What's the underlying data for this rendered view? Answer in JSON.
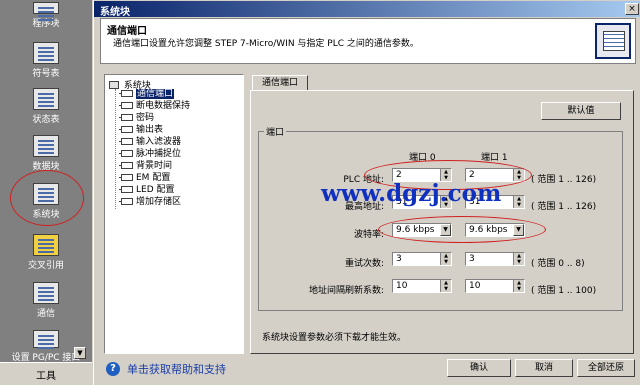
{
  "nav": {
    "items": [
      {
        "label": "程序块"
      },
      {
        "label": "符号表"
      },
      {
        "label": "状态表"
      },
      {
        "label": "数据块"
      },
      {
        "label": "系统块"
      },
      {
        "label": "交叉引用"
      },
      {
        "label": "通信"
      },
      {
        "label": "设置 PG/PC 接口"
      }
    ],
    "tools_label": "工具"
  },
  "dialog": {
    "title": "系统块",
    "close": "×",
    "header_title": "通信端口",
    "header_desc": "通信端口设置允许您调整 STEP 7-Micro/WIN 与指定 PLC 之间的通信参数。"
  },
  "tree": {
    "root": "系统块",
    "items": [
      {
        "label": "通信端口",
        "selected": true
      },
      {
        "label": "断电数据保持"
      },
      {
        "label": "密码"
      },
      {
        "label": "输出表"
      },
      {
        "label": "输入滤波器"
      },
      {
        "label": "脉冲捕捉位"
      },
      {
        "label": "背景时间"
      },
      {
        "label": "EM 配置"
      },
      {
        "label": "LED 配置"
      },
      {
        "label": "增加存储区"
      }
    ]
  },
  "panel": {
    "tab": "通信端口",
    "default_button": "默认值",
    "group_label": "端口",
    "col_port0": "端口 0",
    "col_port1": "端口 1",
    "rows": [
      {
        "label": "PLC 地址:",
        "port0": "2",
        "port1": "2",
        "range": "( 范围 1 .. 126)"
      },
      {
        "label": "最高地址:",
        "port0": "31",
        "port1": "31",
        "range": "( 范围 1 .. 126)"
      },
      {
        "label": "波特率:",
        "port0": "9.6 kbps",
        "port1": "9.6 kbps",
        "range": ""
      },
      {
        "label": "重试次数:",
        "port0": "3",
        "port1": "3",
        "range": "( 范围 0 .. 8)"
      },
      {
        "label": "地址间隔刷新系数:",
        "port0": "10",
        "port1": "10",
        "range": "( 范围 1 .. 100)"
      }
    ],
    "note": "系统块设置参数必须下载才能生效。"
  },
  "watermark": "www.dgzj.com",
  "footer": {
    "help_icon": "?",
    "help_text": "单击获取帮助和支持",
    "ok": "确认",
    "cancel": "取消",
    "restore_all": "全部还原"
  }
}
